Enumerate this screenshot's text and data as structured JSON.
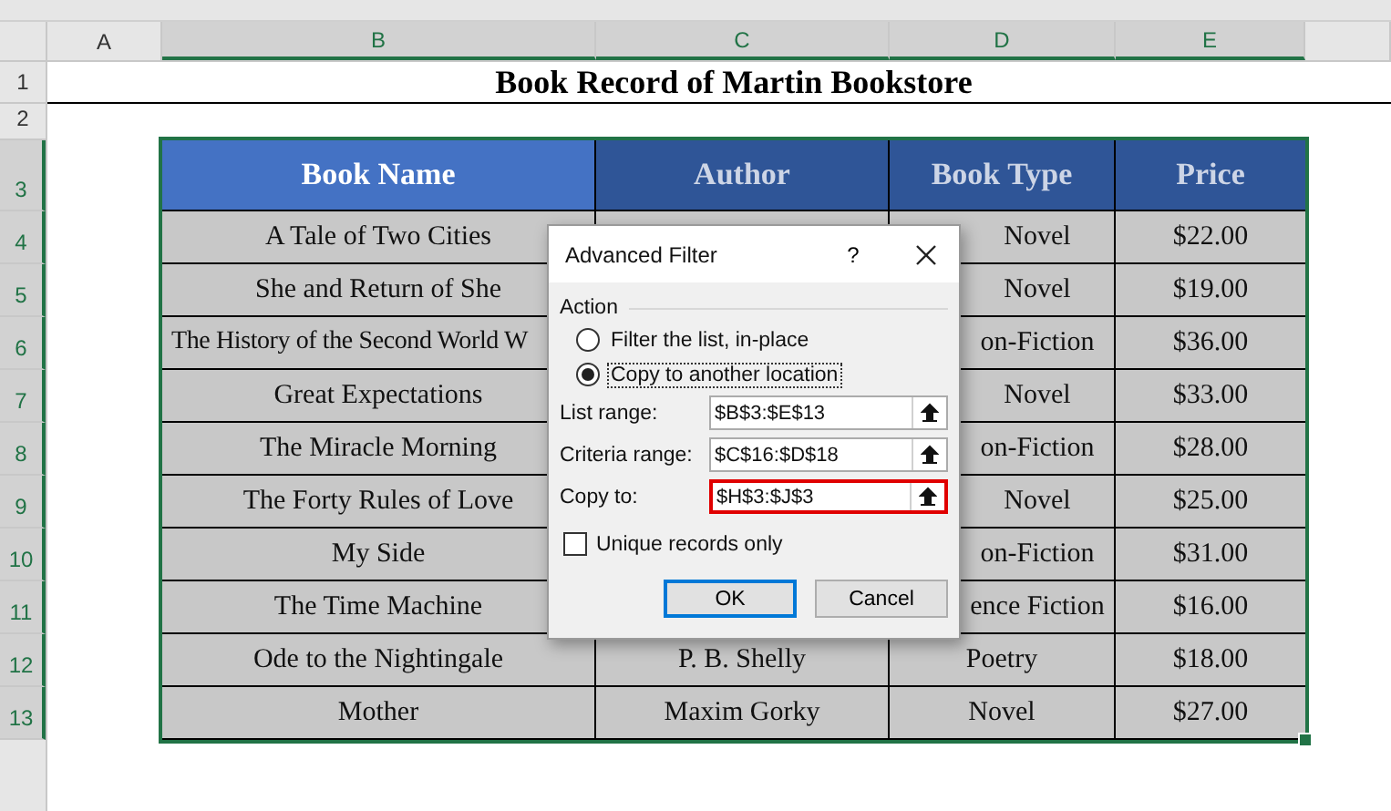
{
  "column_headers": [
    {
      "label": "A",
      "selected": false
    },
    {
      "label": "B",
      "selected": true
    },
    {
      "label": "C",
      "selected": true
    },
    {
      "label": "D",
      "selected": true
    },
    {
      "label": "E",
      "selected": true
    }
  ],
  "row_headers": [
    {
      "label": "1",
      "selected": false
    },
    {
      "label": "2",
      "selected": false
    },
    {
      "label": "3",
      "selected": true
    },
    {
      "label": "4",
      "selected": true
    },
    {
      "label": "5",
      "selected": true
    },
    {
      "label": "6",
      "selected": true
    },
    {
      "label": "7",
      "selected": true
    },
    {
      "label": "8",
      "selected": true
    },
    {
      "label": "9",
      "selected": true
    },
    {
      "label": "10",
      "selected": true
    },
    {
      "label": "11",
      "selected": true
    },
    {
      "label": "12",
      "selected": true
    },
    {
      "label": "13",
      "selected": true
    }
  ],
  "title": "Book Record of Martin Bookstore",
  "table": {
    "columns": [
      "Book Name",
      "Author",
      "Book Type",
      "Price"
    ],
    "rows": [
      {
        "book_name": "A Tale of Two Cities",
        "book_type": "Novel",
        "price": "$22.00"
      },
      {
        "book_name": "She and Return of She",
        "book_type": "Novel",
        "price": "$19.00"
      },
      {
        "book_name": "The History of the Second World W",
        "book_type": "on-Fiction",
        "price": "$36.00"
      },
      {
        "book_name": "Great Expectations",
        "book_type": "Novel",
        "price": "$33.00"
      },
      {
        "book_name": "The Miracle Morning",
        "book_type": "on-Fiction",
        "price": "$28.00"
      },
      {
        "book_name": "The Forty Rules of Love",
        "book_type": "Novel",
        "price": "$25.00"
      },
      {
        "book_name": "My Side",
        "book_type": "on-Fiction",
        "price": "$31.00"
      },
      {
        "book_name": "The Time Machine",
        "book_type": "ence Fiction",
        "price": "$16.00"
      },
      {
        "book_name": "Ode to the Nightingale",
        "author": "P. B. Shelly",
        "book_type": "Poetry",
        "price": "$18.00"
      },
      {
        "book_name": "Mother",
        "author": "Maxim Gorky",
        "book_type": "Novel",
        "price": "$27.00"
      }
    ]
  },
  "dialog": {
    "title": "Advanced Filter",
    "help": "?",
    "group_label": "Action",
    "options": [
      {
        "label": "Filter the list, in-place",
        "selected": false
      },
      {
        "label": "Copy to another location",
        "selected": true
      }
    ],
    "fields": [
      {
        "label": "List range:",
        "value": "$B$3:$E$13",
        "highlighted": false
      },
      {
        "label": "Criteria range:",
        "value": "$C$16:$D$18",
        "highlighted": false
      },
      {
        "label": "Copy to:",
        "value": "$H$3:$J$3",
        "highlighted": true
      }
    ],
    "checkbox": {
      "label": "Unique records only",
      "checked": false
    },
    "buttons": [
      "OK",
      "Cancel"
    ]
  }
}
